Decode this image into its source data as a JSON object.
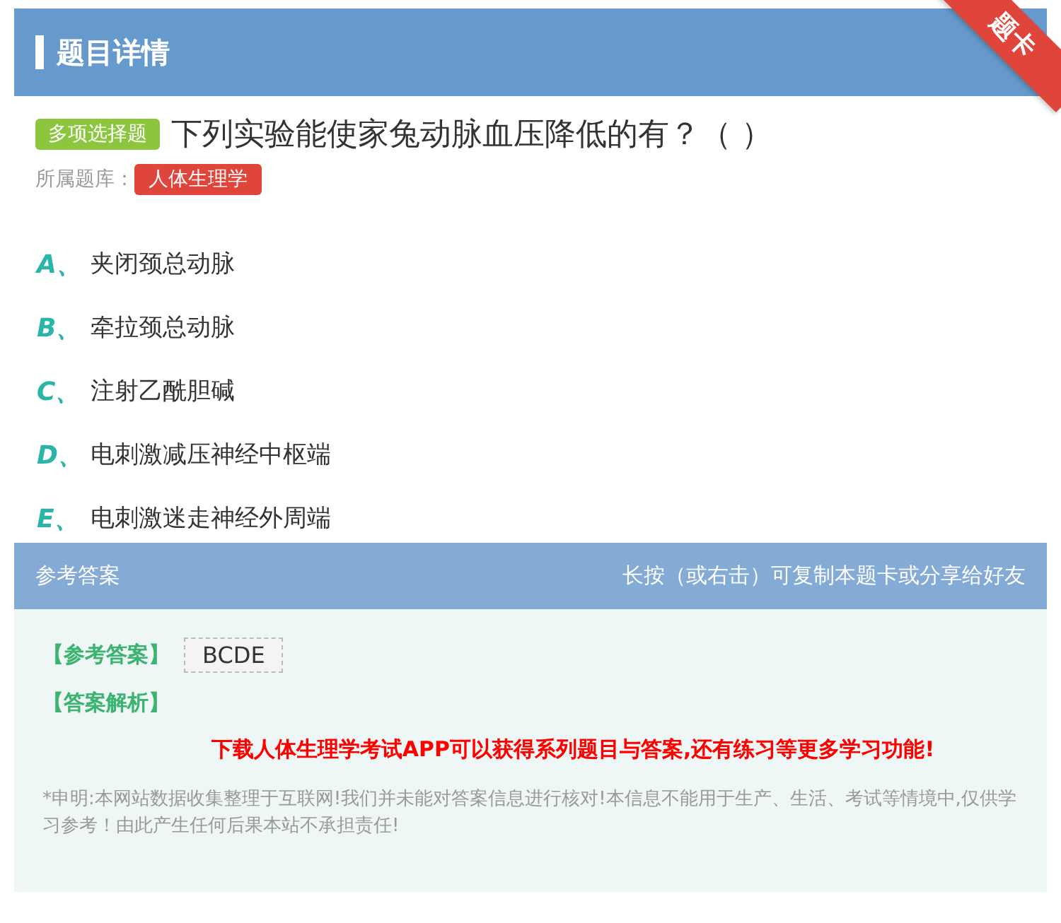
{
  "header": {
    "title": "题目详情",
    "ribbon": "题卡"
  },
  "question": {
    "type_badge": "多项选择题",
    "text": "下列实验能使家兔动脉血压降低的有？（   ）",
    "bank_label": "所属题库：",
    "bank": "人体生理学"
  },
  "options": [
    {
      "letter": "A、",
      "text": "夹闭颈总动脉"
    },
    {
      "letter": "B、",
      "text": "牵拉颈总动脉"
    },
    {
      "letter": "C、",
      "text": "注射乙酰胆碱"
    },
    {
      "letter": "D、",
      "text": "电刺激减压神经中枢端"
    },
    {
      "letter": "E、",
      "text": "电刺激迷走神经外周端"
    }
  ],
  "answer_section": {
    "title": "参考答案",
    "hint": "长按（或右击）可复制本题卡或分享给好友",
    "answer_label": "【参考答案】",
    "answer": "BCDE",
    "analysis_label": "【答案解析】",
    "promo": "下载人体生理学考试APP可以获得系列题目与答案,还有练习等更多学习功能!",
    "disclaimer": "*申明:本网站数据收集整理于互联网!我们并未能对答案信息进行核对!本信息不能用于生产、生活、考试等情境中,仅供学习参考！由此产生任何后果本站不承担责任!"
  }
}
